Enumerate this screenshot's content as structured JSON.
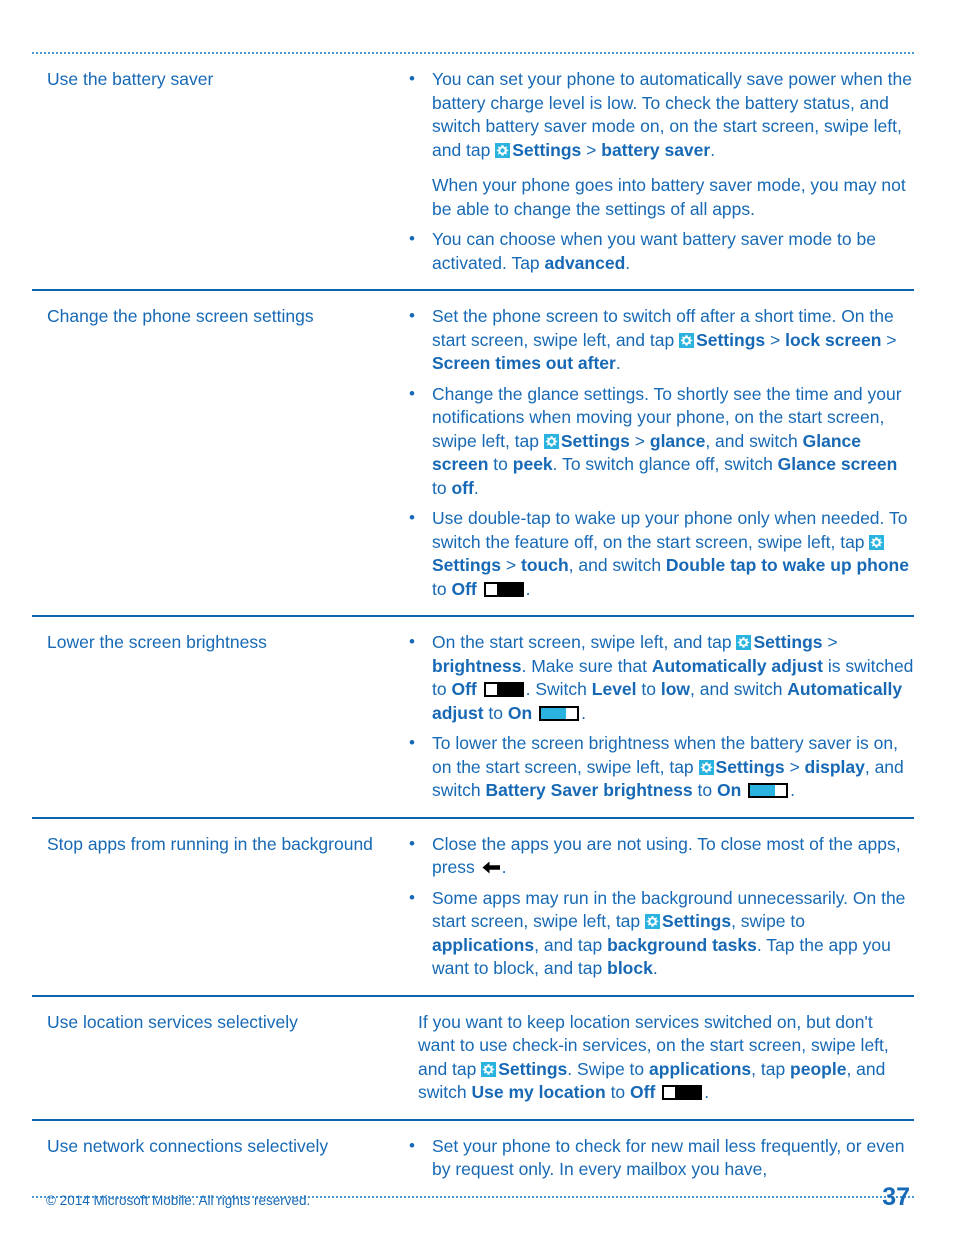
{
  "document": {
    "page_number": "37",
    "copyright": "© 2014 Microsoft Mobile. All rights reserved."
  },
  "icons": {
    "settings_gear": "settings-gear-icon",
    "toggle_off": "toggle-off-icon",
    "toggle_on": "toggle-on-icon",
    "back_arrow": "back-arrow-icon"
  },
  "rows": [
    {
      "term": "Use the battery saver",
      "items": [
        {
          "type": "bullet",
          "segments": [
            {
              "text": "You can set your phone to automatically save power when the battery charge level is low. To check the battery status, and switch battery saver mode on, on the start screen, swipe left, and tap "
            },
            {
              "icon": "settings-gear-icon"
            },
            {
              "text": "Settings",
              "bold": true
            },
            {
              "text": " > "
            },
            {
              "text": "battery saver",
              "bold": true
            },
            {
              "text": "."
            }
          ],
          "sub": [
            {
              "text": "When your phone goes into battery saver mode, you may not be able to change the settings of all apps."
            }
          ]
        },
        {
          "type": "bullet",
          "segments": [
            {
              "text": "You can choose when you want battery saver mode to be activated. Tap "
            },
            {
              "text": "advanced",
              "bold": true
            },
            {
              "text": "."
            }
          ]
        }
      ]
    },
    {
      "term": "Change the phone screen settings",
      "items": [
        {
          "type": "bullet",
          "segments": [
            {
              "text": "Set the phone screen to switch off after a short time. On the start screen, swipe left, and tap "
            },
            {
              "icon": "settings-gear-icon"
            },
            {
              "text": "Settings",
              "bold": true
            },
            {
              "text": " > "
            },
            {
              "text": "lock screen",
              "bold": true
            },
            {
              "text": " > "
            },
            {
              "text": "Screen times out after",
              "bold": true
            },
            {
              "text": "."
            }
          ]
        },
        {
          "type": "bullet",
          "segments": [
            {
              "text": "Change the glance settings. To shortly see the time and your notifications when moving your phone, on the start screen, swipe left, tap "
            },
            {
              "icon": "settings-gear-icon"
            },
            {
              "text": "Settings",
              "bold": true
            },
            {
              "text": " > "
            },
            {
              "text": "glance",
              "bold": true
            },
            {
              "text": ", and switch "
            },
            {
              "text": "Glance screen",
              "bold": true
            },
            {
              "text": " to "
            },
            {
              "text": "peek",
              "bold": true
            },
            {
              "text": ". To switch glance off, switch "
            },
            {
              "text": "Glance screen",
              "bold": true
            },
            {
              "text": " to "
            },
            {
              "text": "off",
              "bold": true
            },
            {
              "text": "."
            }
          ]
        },
        {
          "type": "bullet",
          "segments": [
            {
              "text": "Use double-tap to wake up your phone only when needed. To switch the feature off, on the start screen, swipe left, tap "
            },
            {
              "icon": "settings-gear-icon"
            },
            {
              "text": "Settings",
              "bold": true
            },
            {
              "text": " > "
            },
            {
              "text": "touch",
              "bold": true
            },
            {
              "text": ", and switch "
            },
            {
              "text": "Double tap to wake up phone",
              "bold": true
            },
            {
              "text": " to "
            },
            {
              "text": "Off",
              "bold": true
            },
            {
              "text": " "
            },
            {
              "icon": "toggle-off-icon"
            },
            {
              "text": "."
            }
          ]
        }
      ]
    },
    {
      "term": "Lower the screen brightness",
      "items": [
        {
          "type": "bullet",
          "segments": [
            {
              "text": "On the start screen, swipe left, and tap "
            },
            {
              "icon": "settings-gear-icon"
            },
            {
              "text": "Settings",
              "bold": true
            },
            {
              "text": " > "
            },
            {
              "text": "brightness",
              "bold": true
            },
            {
              "text": ". Make sure that "
            },
            {
              "text": "Automatically adjust",
              "bold": true
            },
            {
              "text": " is switched to "
            },
            {
              "text": "Off",
              "bold": true
            },
            {
              "text": " "
            },
            {
              "icon": "toggle-off-icon"
            },
            {
              "text": ". Switch "
            },
            {
              "text": "Level",
              "bold": true
            },
            {
              "text": " to "
            },
            {
              "text": "low",
              "bold": true
            },
            {
              "text": ", and switch "
            },
            {
              "text": "Automatically adjust",
              "bold": true
            },
            {
              "text": " to "
            },
            {
              "text": "On",
              "bold": true
            },
            {
              "text": " "
            },
            {
              "icon": "toggle-on-icon"
            },
            {
              "text": "."
            }
          ]
        },
        {
          "type": "bullet",
          "segments": [
            {
              "text": "To lower the screen brightness when the battery saver is on, on the start screen, swipe left, tap "
            },
            {
              "icon": "settings-gear-icon"
            },
            {
              "text": "Settings",
              "bold": true
            },
            {
              "text": " > "
            },
            {
              "text": "display",
              "bold": true
            },
            {
              "text": ", and switch "
            },
            {
              "text": "Battery Saver brightness",
              "bold": true
            },
            {
              "text": " to "
            },
            {
              "text": "On",
              "bold": true
            },
            {
              "text": " "
            },
            {
              "icon": "toggle-on-icon"
            },
            {
              "text": "."
            }
          ]
        }
      ]
    },
    {
      "term": "Stop apps from running in the background",
      "items": [
        {
          "type": "bullet",
          "segments": [
            {
              "text": "Close the apps you are not using. To close most of the apps, press "
            },
            {
              "icon": "back-arrow-icon"
            },
            {
              "text": "."
            }
          ]
        },
        {
          "type": "bullet",
          "segments": [
            {
              "text": "Some apps may run in the background unnecessarily. On the start screen, swipe left, tap "
            },
            {
              "icon": "settings-gear-icon"
            },
            {
              "text": "Settings",
              "bold": true
            },
            {
              "text": ", swipe to "
            },
            {
              "text": "applications",
              "bold": true
            },
            {
              "text": ", and tap "
            },
            {
              "text": "background tasks",
              "bold": true
            },
            {
              "text": ". Tap the app you want to block, and tap "
            },
            {
              "text": "block",
              "bold": true
            },
            {
              "text": "."
            }
          ]
        }
      ]
    },
    {
      "term": "Use location services selectively",
      "items": [
        {
          "type": "plain",
          "segments": [
            {
              "text": "If you want to keep location services switched on, but don't want to use check-in services, on the start screen, swipe left, and tap "
            },
            {
              "icon": "settings-gear-icon"
            },
            {
              "text": "Settings",
              "bold": true
            },
            {
              "text": ". Swipe to "
            },
            {
              "text": "applications",
              "bold": true
            },
            {
              "text": ", tap "
            },
            {
              "text": "people",
              "bold": true
            },
            {
              "text": ", and switch "
            },
            {
              "text": "Use my location",
              "bold": true
            },
            {
              "text": " to "
            },
            {
              "text": "Off",
              "bold": true
            },
            {
              "text": " "
            },
            {
              "icon": "toggle-off-icon"
            },
            {
              "text": "."
            }
          ]
        }
      ]
    },
    {
      "term": "Use network connections selectively",
      "items": [
        {
          "type": "bullet",
          "segments": [
            {
              "text": "Set your phone to check for new mail less frequently, or even by request only. In every mailbox you have,"
            }
          ]
        }
      ]
    }
  ]
}
